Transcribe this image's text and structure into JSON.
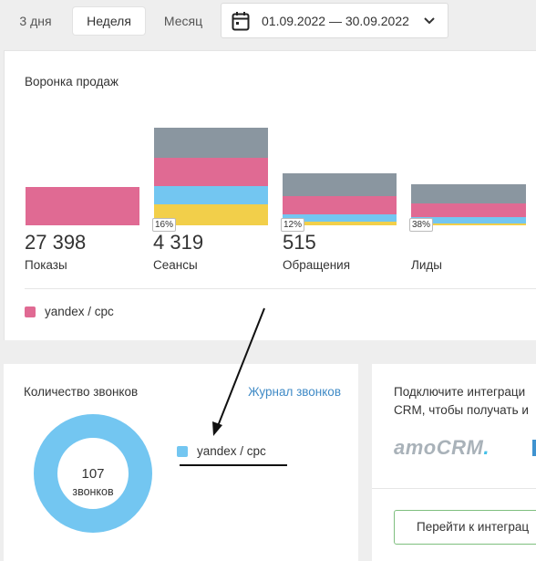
{
  "periods": {
    "three_days": "3 дня",
    "week": "Неделя",
    "month": "Месяц",
    "active": "Неделя"
  },
  "date_range": {
    "value": "01.09.2022 — 30.09.2022",
    "icon": "calendar-icon"
  },
  "funnel": {
    "title": "Воронка продаж",
    "colors": {
      "gray": "#8a96a0",
      "pink": "#e06a93",
      "blue": "#73c6f1",
      "yellow": "#f2cf4a"
    },
    "stages": [
      {
        "label": "Показы",
        "value": "27 398",
        "percent": ""
      },
      {
        "label": "Сеансы",
        "value": "4 319",
        "percent": "16%"
      },
      {
        "label": "Обращения",
        "value": "515",
        "percent": "12%"
      },
      {
        "label": "Лиды",
        "value": "",
        "percent": "38%"
      }
    ],
    "legend": [
      {
        "label": "yandex / cpc",
        "color": "#e06a93"
      }
    ]
  },
  "calls": {
    "title": "Количество звонков",
    "link": "Журнал звонков",
    "total_value": "107",
    "total_label": "звонков",
    "legend": [
      {
        "label": "yandex / cpc",
        "color": "#73c6f1"
      }
    ],
    "donut_color": "#73c6f1"
  },
  "crm": {
    "text_line1": "Подключите интеграци",
    "text_line2": "CRM, чтобы получать и",
    "logo_prefix": "amoCRM",
    "logo_suffix": ".",
    "button": "Перейти к интеграц"
  }
}
